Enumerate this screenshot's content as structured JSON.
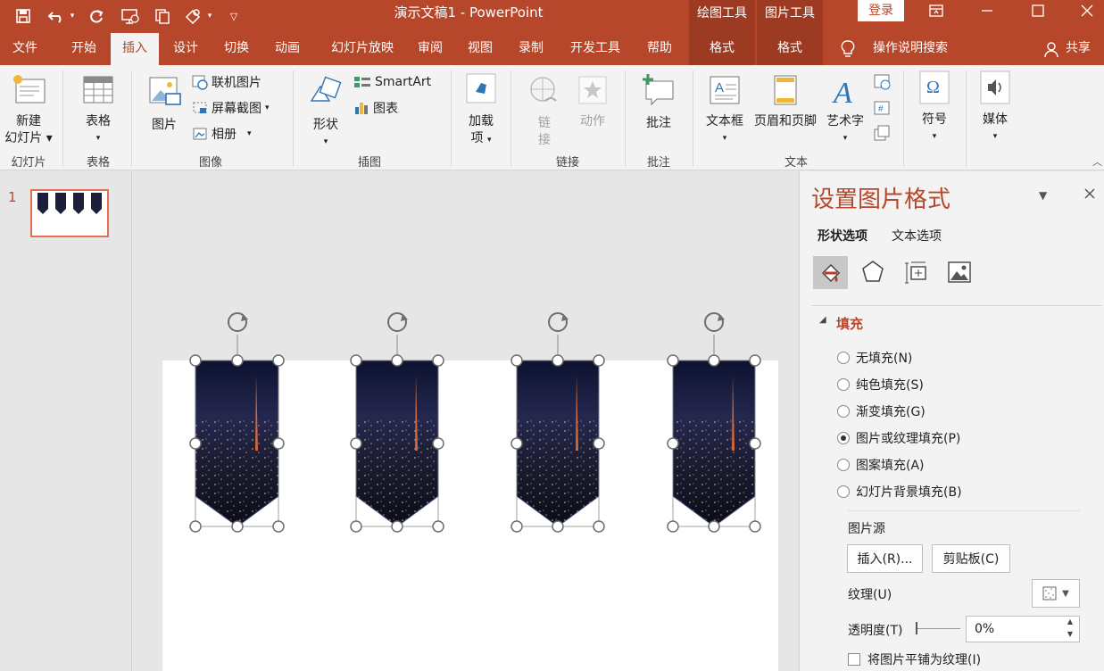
{
  "app": {
    "doc_title": "演示文稿1  -  PowerPoint"
  },
  "context_tabs": {
    "drawing_tools": "绘图工具",
    "picture_tools": "图片工具"
  },
  "login_label": "登录",
  "tabs": [
    {
      "label": "文件"
    },
    {
      "label": "开始"
    },
    {
      "label": "插入"
    },
    {
      "label": "设计"
    },
    {
      "label": "切换"
    },
    {
      "label": "动画"
    },
    {
      "label": "幻灯片放映"
    },
    {
      "label": "审阅"
    },
    {
      "label": "视图"
    },
    {
      "label": "录制"
    },
    {
      "label": "开发工具"
    },
    {
      "label": "帮助"
    },
    {
      "label": "格式"
    },
    {
      "label": "格式"
    }
  ],
  "tell_me": "操作说明搜索",
  "share": "共享",
  "ribbon": {
    "slides": {
      "new_slide_1": "新建",
      "new_slide_2": "幻灯片",
      "group": "幻灯片"
    },
    "tables": {
      "table": "表格",
      "group": "表格"
    },
    "images": {
      "picture": "图片",
      "online_pictures": "联机图片",
      "screenshot": "屏幕截图",
      "album": "相册",
      "group": "图像"
    },
    "illustrations": {
      "shapes": "形状",
      "smartart": "SmartArt",
      "chart": "图表",
      "group": "插图"
    },
    "addins": {
      "label_1": "加载",
      "label_2": "项"
    },
    "links": {
      "link_1": "链",
      "link_2": "接",
      "action": "动作",
      "group": "链接"
    },
    "comments": {
      "comment": "批注",
      "group": "批注"
    },
    "text": {
      "textbox": "文本框",
      "header_footer": "页眉和页脚",
      "wordart": "艺术字",
      "group": "文本"
    },
    "symbols": {
      "symbol": "符号"
    },
    "media": {
      "media": "媒体"
    }
  },
  "thumbnail": {
    "number": "1"
  },
  "panel": {
    "title": "设置图片格式",
    "tab_shape": "形状选项",
    "tab_text": "文本选项",
    "section_fill": "填充",
    "fill_options": [
      {
        "label": "无填充(N)",
        "selected": false
      },
      {
        "label": "纯色填充(S)",
        "selected": false
      },
      {
        "label": "渐变填充(G)",
        "selected": false
      },
      {
        "label": "图片或纹理填充(P)",
        "selected": true
      },
      {
        "label": "图案填充(A)",
        "selected": false
      },
      {
        "label": "幻灯片背景填充(B)",
        "selected": false
      }
    ],
    "picture_source": "图片源",
    "insert_btn": "插入(R)...",
    "clipboard_btn": "剪贴板(C)",
    "texture_label": "纹理(U)",
    "transparency_label": "透明度(T)",
    "transparency_value": "0%",
    "tile_label": "将图片平铺为纹理(I)"
  },
  "colors": {
    "accent": "#b7472a",
    "context": "#9c3b22"
  }
}
